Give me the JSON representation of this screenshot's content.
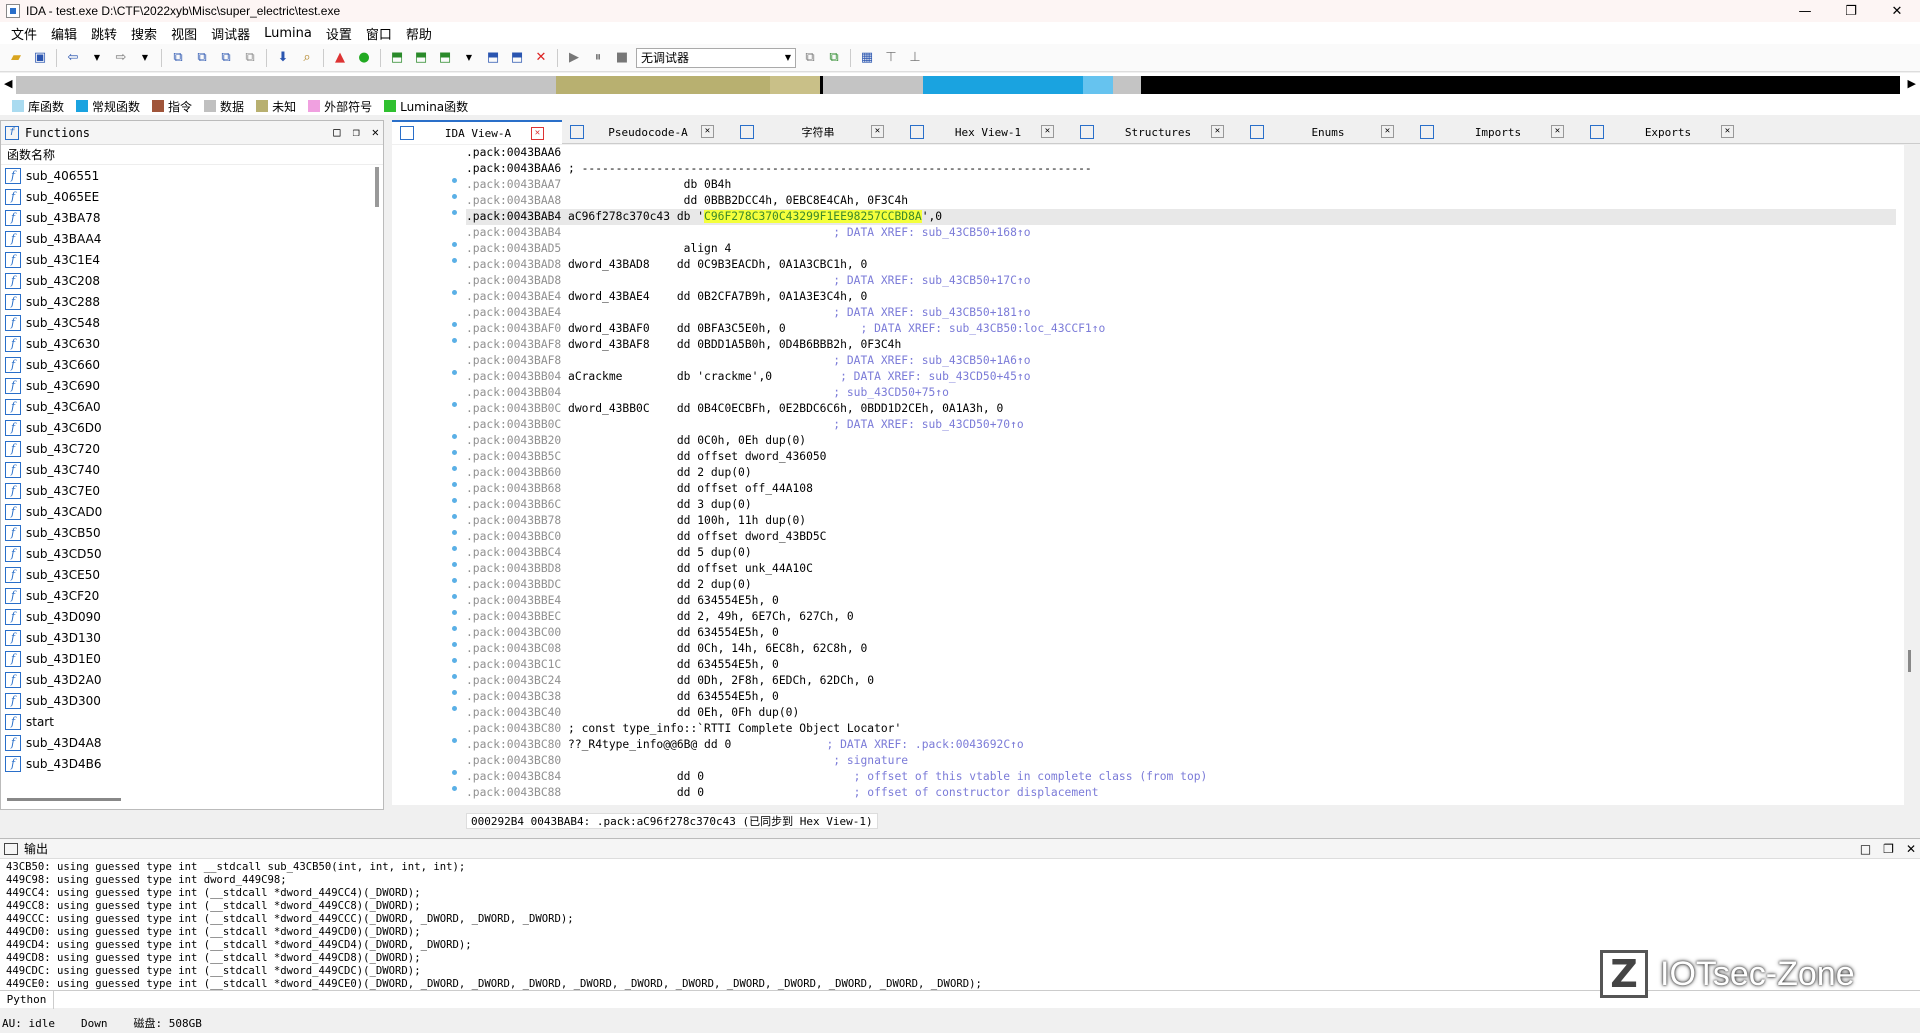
{
  "window": {
    "title": "IDA - test.exe D:\\CTF\\2022xyb\\Misc\\super_electric\\test.exe",
    "minimize": "—",
    "maximize": "❐",
    "close": "✕"
  },
  "menu": [
    "文件",
    "编辑",
    "跳转",
    "搜索",
    "视图",
    "调试器",
    "Lumina",
    "设置",
    "窗口",
    "帮助"
  ],
  "toolbar": {
    "debugger_select": "无调试器"
  },
  "legend": [
    {
      "label": "库函数",
      "color": "#aadbf0"
    },
    {
      "label": "常规函数",
      "color": "#1aa3e0"
    },
    {
      "label": "指令",
      "color": "#a0553a"
    },
    {
      "label": "数据",
      "color": "#c0c0c0"
    },
    {
      "label": "未知",
      "color": "#b8b070"
    },
    {
      "label": "外部符号",
      "color": "#f0a0e0"
    },
    {
      "label": "Lumina函数",
      "color": "#30c030"
    }
  ],
  "functions": {
    "title": "Functions",
    "header": "函数名称",
    "items": [
      "sub_406551",
      "sub_4065EE",
      "sub_43BA78",
      "sub_43BAA4",
      "sub_43C1E4",
      "sub_43C208",
      "sub_43C288",
      "sub_43C548",
      "sub_43C630",
      "sub_43C660",
      "sub_43C690",
      "sub_43C6A0",
      "sub_43C6D0",
      "sub_43C720",
      "sub_43C740",
      "sub_43C7E0",
      "sub_43CAD0",
      "sub_43CB50",
      "sub_43CD50",
      "sub_43CE50",
      "sub_43CF20",
      "sub_43D090",
      "sub_43D130",
      "sub_43D1E0",
      "sub_43D2A0",
      "sub_43D300",
      "start",
      "sub_43D4A8",
      "sub_43D4B6"
    ]
  },
  "tabs": [
    "IDA View-A",
    "Pseudocode-A",
    "字符串",
    "Hex View-1",
    "Structures",
    "Enums",
    "Imports",
    "Exports"
  ],
  "disasm": [
    {
      "addr": ".pack:0043BAA6",
      "rest": ""
    },
    {
      "addr": ".pack:0043BAA6",
      "rest": " ; ---------------------------------------------------------------------------"
    },
    {
      "addr": ".pack:0043BAA7",
      "rest": "                  db 0B4h"
    },
    {
      "addr": ".pack:0043BAA8",
      "rest": "                  dd 0BBB2DCC4h, 0EBC8E4CAh, 0F3C4h"
    },
    {
      "addr": ".pack:0043BAB4",
      "rest": " aC96f278c370c43 db '",
      "hi": "C96F278C370C43299F1EE98257CCBD8A",
      "tail": "',0"
    },
    {
      "addr": ".pack:0043BAB4",
      "cm": "                                        ; DATA XREF: sub_43CB50+168↑o"
    },
    {
      "addr": ".pack:0043BAD5",
      "rest": "                  align 4"
    },
    {
      "addr": ".pack:0043BAD8",
      "rest": " dword_43BAD8    dd 0C9B3EACDh, 0A1A3CBC1h, 0"
    },
    {
      "addr": ".pack:0043BAD8",
      "cm": "                                        ; DATA XREF: sub_43CB50+17C↑o"
    },
    {
      "addr": ".pack:0043BAE4",
      "rest": " dword_43BAE4    dd 0B2CFA7B9h, 0A1A3E3C4h, 0"
    },
    {
      "addr": ".pack:0043BAE4",
      "cm": "                                        ; DATA XREF: sub_43CB50+181↑o"
    },
    {
      "addr": ".pack:0043BAF0",
      "rest": " dword_43BAF0    dd 0BFA3C5E0h, 0",
      "cm2": "           ; DATA XREF: sub_43CB50:loc_43CCF1↑o"
    },
    {
      "addr": ".pack:0043BAF8",
      "rest": " dword_43BAF8    dd 0BDD1A5B0h, 0D4B6BBB2h, 0F3C4h"
    },
    {
      "addr": ".pack:0043BAF8",
      "cm": "                                        ; DATA XREF: sub_43CB50+1A6↑o"
    },
    {
      "addr": ".pack:0043BB04",
      "rest": " aCrackme        db 'crackme',0",
      "cm2": "          ; DATA XREF: sub_43CD50+45↑o"
    },
    {
      "addr": ".pack:0043BB04",
      "cm": "                                        ; sub_43CD50+75↑o"
    },
    {
      "addr": ".pack:0043BB0C",
      "rest": " dword_43BB0C    dd 0B4C0ECBFh, 0E2BDC6C6h, 0BDD1D2CEh, 0A1A3h, 0"
    },
    {
      "addr": ".pack:0043BB0C",
      "cm": "                                        ; DATA XREF: sub_43CD50+70↑o"
    },
    {
      "addr": ".pack:0043BB20",
      "rest": "                 dd 0C0h, 0Eh dup(0)"
    },
    {
      "addr": ".pack:0043BB5C",
      "rest": "                 dd offset dword_436050"
    },
    {
      "addr": ".pack:0043BB60",
      "rest": "                 dd 2 dup(0)"
    },
    {
      "addr": ".pack:0043BB68",
      "rest": "                 dd offset off_44A108"
    },
    {
      "addr": ".pack:0043BB6C",
      "rest": "                 dd 3 dup(0)"
    },
    {
      "addr": ".pack:0043BB78",
      "rest": "                 dd 100h, 11h dup(0)"
    },
    {
      "addr": ".pack:0043BBC0",
      "rest": "                 dd offset dword_43BD5C"
    },
    {
      "addr": ".pack:0043BBC4",
      "rest": "                 dd 5 dup(0)"
    },
    {
      "addr": ".pack:0043BBD8",
      "rest": "                 dd offset unk_44A10C"
    },
    {
      "addr": ".pack:0043BBDC",
      "rest": "                 dd 2 dup(0)"
    },
    {
      "addr": ".pack:0043BBE4",
      "rest": "                 dd 634554E5h, 0"
    },
    {
      "addr": ".pack:0043BBEC",
      "rest": "                 dd 2, 49h, 6E7Ch, 627Ch, 0"
    },
    {
      "addr": ".pack:0043BC00",
      "rest": "                 dd 634554E5h, 0"
    },
    {
      "addr": ".pack:0043BC08",
      "rest": "                 dd 0Ch, 14h, 6EC8h, 62C8h, 0"
    },
    {
      "addr": ".pack:0043BC1C",
      "rest": "                 dd 634554E5h, 0"
    },
    {
      "addr": ".pack:0043BC24",
      "rest": "                 dd 0Dh, 2F8h, 6EDCh, 62DCh, 0"
    },
    {
      "addr": ".pack:0043BC38",
      "rest": "                 dd 634554E5h, 0"
    },
    {
      "addr": ".pack:0043BC40",
      "rest": "                 dd 0Eh, 0Fh dup(0)"
    },
    {
      "addr": ".pack:0043BC80",
      "rest": " ; const type_info::`RTTI Complete Object Locator'"
    },
    {
      "addr": ".pack:0043BC80",
      "rest": " ??_R4type_info@@6B@ dd 0",
      "cm2": "              ; DATA XREF: .pack:0043692C↑o"
    },
    {
      "addr": ".pack:0043BC80",
      "cm": "                                        ; signature"
    },
    {
      "addr": ".pack:0043BC84",
      "rest": "                 dd 0",
      "cm2": "                      ; offset of this vtable in complete class (from top)"
    },
    {
      "addr": ".pack:0043BC88",
      "rest": "                 dd 0",
      "cm2": "                      ; offset of constructor displacement"
    }
  ],
  "status_line": "000292B4 0043BAB4: .pack:aC96f278c370c43 (已同步到 Hex View-1)",
  "output": {
    "title": "输出",
    "lines": [
      "43CB50: using guessed type int __stdcall sub_43CB50(int, int, int, int);",
      "449C98: using guessed type int dword_449C98;",
      "449CC4: using guessed type int (__stdcall *dword_449CC4)(_DWORD);",
      "449CC8: using guessed type int (__stdcall *dword_449CC8)(_DWORD);",
      "449CCC: using guessed type int (__stdcall *dword_449CCC)(_DWORD, _DWORD, _DWORD, _DWORD);",
      "449CD0: using guessed type int (__stdcall *dword_449CD0)(_DWORD);",
      "449CD4: using guessed type int (__stdcall *dword_449CD4)(_DWORD, _DWORD);",
      "449CD8: using guessed type int (__stdcall *dword_449CD8)(_DWORD);",
      "449CDC: using guessed type int (__stdcall *dword_449CDC)(_DWORD);",
      "449CE0: using guessed type int (__stdcall *dword_449CE0)(_DWORD, _DWORD, _DWORD, _DWORD, _DWORD, _DWORD, _DWORD, _DWORD, _DWORD, _DWORD, _DWORD, _DWORD);"
    ]
  },
  "python_label": "Python",
  "statusbar": {
    "au": "AU:  idle",
    "dir": "Down",
    "disk": "磁盘: 508GB"
  },
  "watermark": {
    "logo": "Z",
    "text": "IOTsec-Zone"
  }
}
